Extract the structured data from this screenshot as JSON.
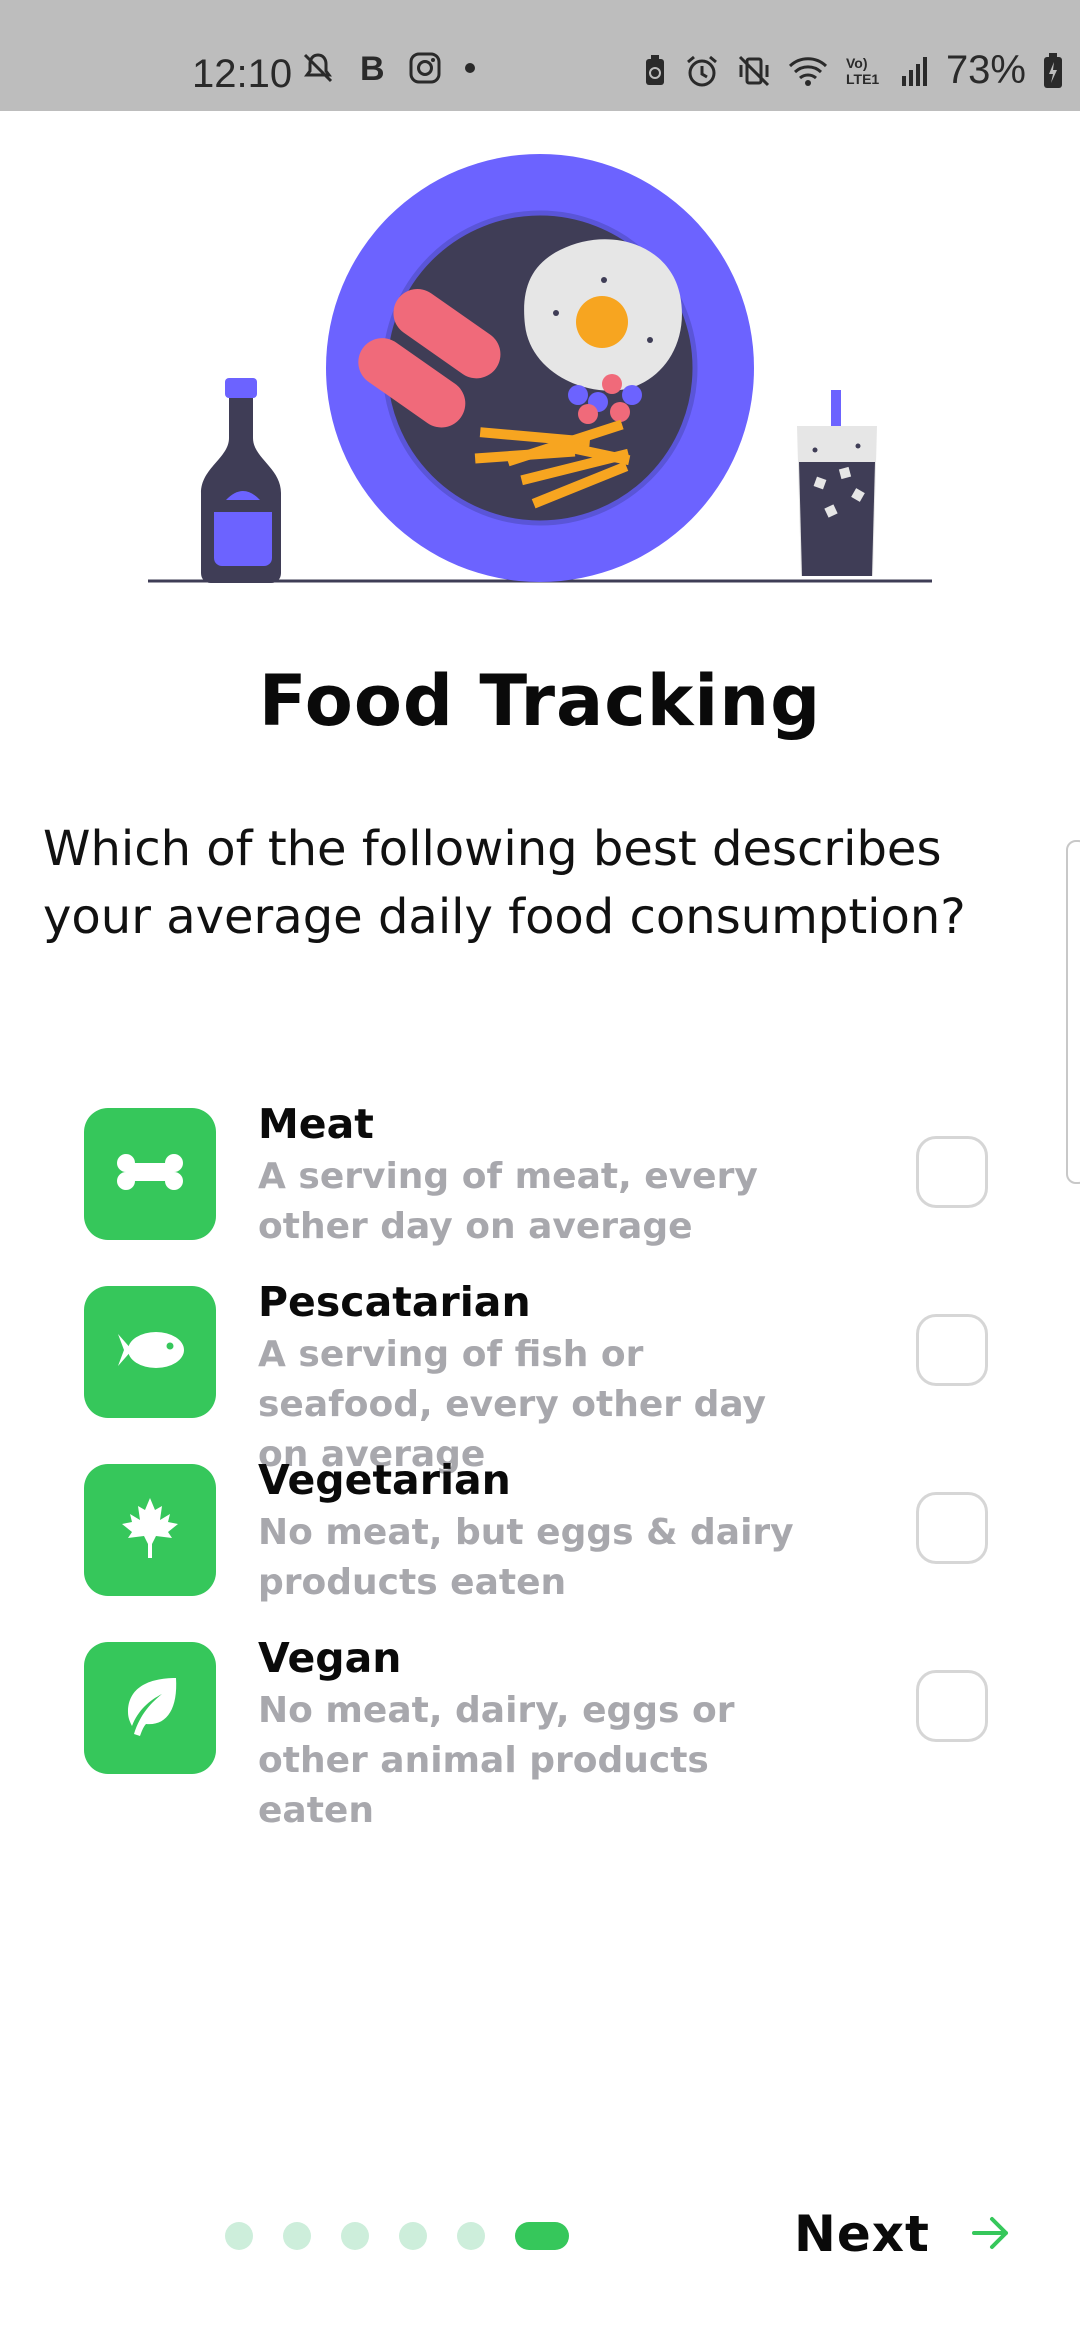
{
  "status_bar": {
    "time": "12:10",
    "battery": "73%"
  },
  "title": "Food Tracking",
  "question": "Which of the following best describes your average daily food consumption?",
  "options": [
    {
      "title": "Meat",
      "description": "A serving of meat, every other day on average",
      "icon": "bone-icon",
      "checked": false
    },
    {
      "title": "Pescatarian",
      "description": "A serving of fish or seafood, every other day on average",
      "icon": "fish-icon",
      "checked": false
    },
    {
      "title": "Vegetarian",
      "description": "No meat, but eggs & dairy products eaten",
      "icon": "maple-leaf-icon",
      "checked": false
    },
    {
      "title": "Vegan",
      "description": "No meat, dairy, eggs or other animal products eaten",
      "icon": "leaf-icon",
      "checked": false
    }
  ],
  "pager": {
    "total": 6,
    "current": 6
  },
  "next_label": "Next",
  "colors": {
    "accent": "#36c75b",
    "plate": "#6c63ff",
    "dark": "#3f3d56",
    "muted_text": "#a8a8ad"
  }
}
